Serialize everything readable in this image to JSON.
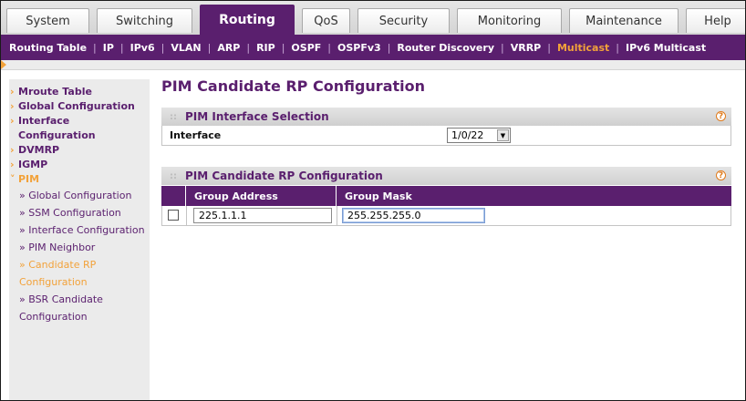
{
  "tabs": [
    {
      "label": "System",
      "active": false
    },
    {
      "label": "Switching",
      "active": false
    },
    {
      "label": "Routing",
      "active": true
    },
    {
      "label": "QoS",
      "active": false
    },
    {
      "label": "Security",
      "active": false
    },
    {
      "label": "Monitoring",
      "active": false
    },
    {
      "label": "Maintenance",
      "active": false
    },
    {
      "label": "Help",
      "active": false
    }
  ],
  "subnav": [
    {
      "label": "Routing Table",
      "active": false
    },
    {
      "label": "IP",
      "active": false
    },
    {
      "label": "IPv6",
      "active": false
    },
    {
      "label": "VLAN",
      "active": false
    },
    {
      "label": "ARP",
      "active": false
    },
    {
      "label": "RIP",
      "active": false
    },
    {
      "label": "OSPF",
      "active": false
    },
    {
      "label": "OSPFv3",
      "active": false
    },
    {
      "label": "Router Discovery",
      "active": false
    },
    {
      "label": "VRRP",
      "active": false
    },
    {
      "label": "Multicast",
      "active": true
    },
    {
      "label": "IPv6 Multicast",
      "active": false
    }
  ],
  "sidebar": {
    "items": [
      {
        "label": "Mroute Table",
        "caret": "›"
      },
      {
        "label": "Global Configuration",
        "caret": "›"
      },
      {
        "label": "Interface Configuration",
        "caret": "›"
      },
      {
        "label": "DVMRP",
        "caret": "›"
      },
      {
        "label": "IGMP",
        "caret": "›"
      },
      {
        "label": "PIM",
        "caret": "˅"
      }
    ],
    "pim_subitems": [
      {
        "label": "» Global Configuration",
        "active": false
      },
      {
        "label": "» SSM Configuration",
        "active": false
      },
      {
        "label": "» Interface Configuration",
        "active": false
      },
      {
        "label": "» PIM Neighbor",
        "active": false
      },
      {
        "label": "» Candidate RP Configuration",
        "active": true
      },
      {
        "label": "» BSR Candidate Configuration",
        "active": false
      }
    ]
  },
  "page": {
    "title": "PIM Candidate RP Configuration"
  },
  "interface_panel": {
    "title": "PIM Interface Selection",
    "help_icon": "?",
    "interface_label": "Interface",
    "interface_value": "1/0/22"
  },
  "rp_panel": {
    "title": "PIM Candidate RP Configuration",
    "help_icon": "?",
    "columns": [
      "Group Address",
      "Group Mask"
    ],
    "group_address_value": "225.1.1.1",
    "group_mask_value": "255.255.255.0"
  },
  "colors": {
    "brand_purple": "#5a1f6e",
    "accent_orange": "#f2a23a"
  }
}
